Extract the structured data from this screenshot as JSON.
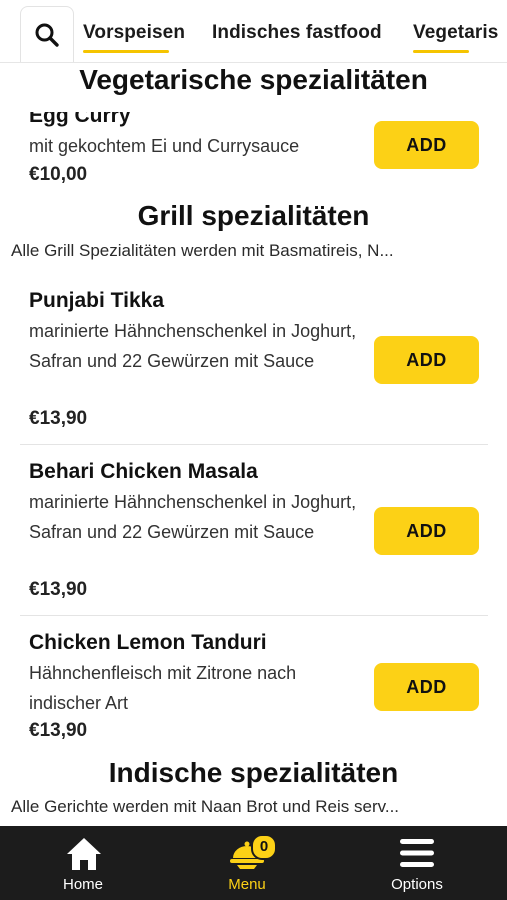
{
  "categories": [
    {
      "label": "Vorspeisen",
      "active": true
    },
    {
      "label": "Indisches fastfood",
      "active": false
    },
    {
      "label": "Vegetaris",
      "active": true
    }
  ],
  "sections": {
    "vegetarian": {
      "title": "Vegetarische spezialitäten"
    },
    "grill": {
      "title": "Grill spezialitäten",
      "subtitle": "Alle Grill Spezialitäten werden mit Basmatireis, N..."
    },
    "indian": {
      "title": "Indische spezialitäten",
      "subtitle": "Alle Gerichte werden mit Naan Brot und Reis serv..."
    }
  },
  "items": [
    {
      "name": "Egg Curry",
      "desc": "mit gekochtem Ei und Currysauce",
      "price": "€10,00",
      "add_label": "ADD"
    },
    {
      "name": "Punjabi Tikka",
      "desc": "marinierte Hähnchenschenkel in Joghurt, Safran und 22 Gewürzen mit Sauce",
      "price": "€13,90",
      "add_label": "ADD"
    },
    {
      "name": "Behari Chicken Masala",
      "desc": "marinierte Hähnchenschenkel in Joghurt, Safran und 22 Gewürzen mit Sauce",
      "price": "€13,90",
      "add_label": "ADD"
    },
    {
      "name": "Chicken Lemon Tanduri",
      "desc": "Hähnchenfleisch mit Zitrone nach indischer Art",
      "price": "€13,90",
      "add_label": "ADD"
    }
  ],
  "nav": {
    "home": "Home",
    "menu": "Menu",
    "options": "Options",
    "cart_count": "0"
  },
  "colors": {
    "accent": "#fcd116",
    "nav_bg": "#1c1c1c"
  },
  "icons": [
    "search-icon",
    "home-icon",
    "cloche-icon",
    "menu-icon"
  ]
}
